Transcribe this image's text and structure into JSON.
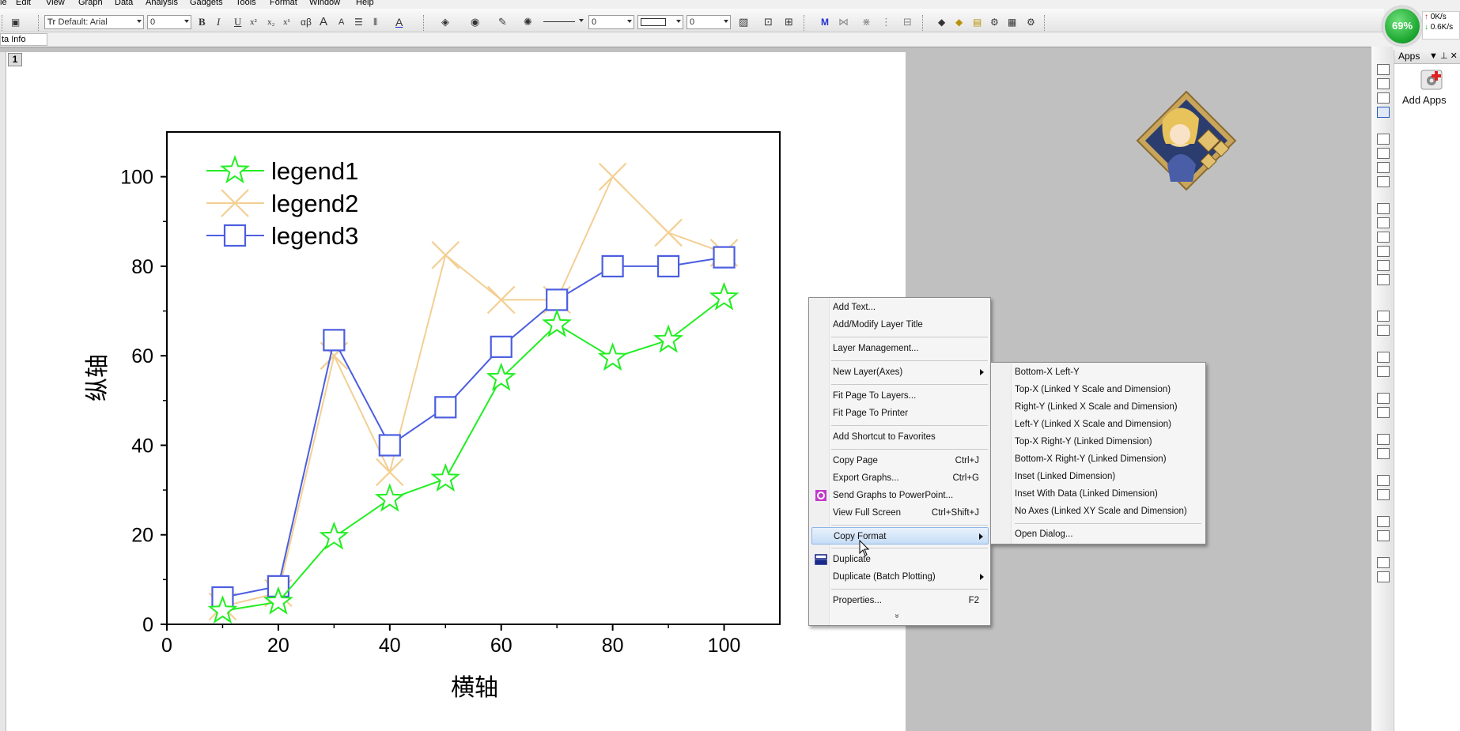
{
  "menubar": {
    "items": [
      "le",
      "Edit",
      "View",
      "Graph",
      "Data",
      "Analysis",
      "Gadgets",
      "Tools",
      "Format",
      "Window",
      "Help"
    ]
  },
  "toolbar": {
    "font_name": "Default: Arial",
    "font_size": "0",
    "line_width_value": "0",
    "size_value": "0",
    "glyphs": {
      "bold": "B",
      "italic": "I",
      "underline": "U",
      "superscript": "x²",
      "subscript": "x₂",
      "greek": "αβ",
      "grow_font": "A",
      "shrink_font": "A",
      "font_color": "A",
      "cursor_tool": "M"
    }
  },
  "info_tab": {
    "label": "ta Info"
  },
  "layer_tag": {
    "label": "1"
  },
  "status_badge": {
    "percent": "69%",
    "upload": "0K/s",
    "download": "0.6K/s"
  },
  "chart_data": {
    "type": "line",
    "xlabel": "横轴",
    "ylabel": "纵轴",
    "xlim": [
      0,
      110
    ],
    "ylim": [
      0,
      110
    ],
    "xticks": [
      0,
      20,
      40,
      60,
      80,
      100
    ],
    "yticks": [
      0,
      20,
      40,
      60,
      80,
      100
    ],
    "legend_position": "top-left",
    "series": [
      {
        "name": "legend1",
        "marker": "star",
        "color": "#22ee22",
        "x": [
          10,
          20,
          30,
          40,
          50,
          60,
          70,
          80,
          90,
          100
        ],
        "y": [
          3,
          5,
          19.5,
          28,
          32.5,
          55,
          67,
          59.5,
          63.5,
          73
        ]
      },
      {
        "name": "legend2",
        "marker": "x",
        "color": "#f3cf93",
        "x": [
          10,
          20,
          30,
          40,
          50,
          60,
          70,
          80,
          90,
          100
        ],
        "y": [
          4,
          7,
          60,
          34,
          82.5,
          72.5,
          72.5,
          100,
          87.5,
          83
        ]
      },
      {
        "name": "legend3",
        "marker": "square",
        "color": "#4c5ee0",
        "x": [
          10,
          20,
          30,
          40,
          50,
          60,
          70,
          80,
          90,
          100
        ],
        "y": [
          6,
          8.5,
          63.5,
          40,
          48.5,
          62,
          72.5,
          80,
          80,
          82
        ]
      }
    ]
  },
  "context_menu": {
    "items": [
      {
        "label": "Add Text...",
        "shortcut": ""
      },
      {
        "label": "Add/Modify Layer Title",
        "shortcut": ""
      },
      {
        "label": "Layer Management...",
        "shortcut": ""
      },
      {
        "label": "New Layer(Axes)",
        "shortcut": "",
        "submenu": true
      },
      {
        "label": "Fit Page To Layers...",
        "shortcut": ""
      },
      {
        "label": "Fit Page To Printer",
        "shortcut": ""
      },
      {
        "label": "Add Shortcut to Favorites",
        "shortcut": ""
      },
      {
        "label": "Copy Page",
        "shortcut": "Ctrl+J"
      },
      {
        "label": "Export Graphs...",
        "shortcut": "Ctrl+G"
      },
      {
        "label": "Send Graphs to PowerPoint...",
        "shortcut": ""
      },
      {
        "label": "View Full Screen",
        "shortcut": "Ctrl+Shift+J"
      },
      {
        "label": "Copy Format",
        "shortcut": "",
        "submenu": true,
        "highlighted": true
      },
      {
        "label": "Duplicate",
        "shortcut": ""
      },
      {
        "label": "Duplicate (Batch Plotting)",
        "shortcut": "",
        "submenu": true
      },
      {
        "label": "Properties...",
        "shortcut": "F2"
      }
    ],
    "more_glyph": "»"
  },
  "submenu": {
    "items": [
      "Bottom-X Left-Y",
      "Top-X (Linked Y Scale and Dimension)",
      "Right-Y (Linked X Scale and Dimension)",
      "Left-Y (Linked X Scale and Dimension)",
      "Top-X Right-Y (Linked Dimension)",
      "Bottom-X Right-Y (Linked Dimension)",
      "Inset (Linked Dimension)",
      "Inset With Data (Linked Dimension)",
      "No Axes (Linked XY Scale and Dimension)",
      "Open Dialog..."
    ]
  },
  "apps_panel": {
    "title": "Apps",
    "add_label": "Add Apps",
    "pin": "▼ ⊥ ✕"
  }
}
